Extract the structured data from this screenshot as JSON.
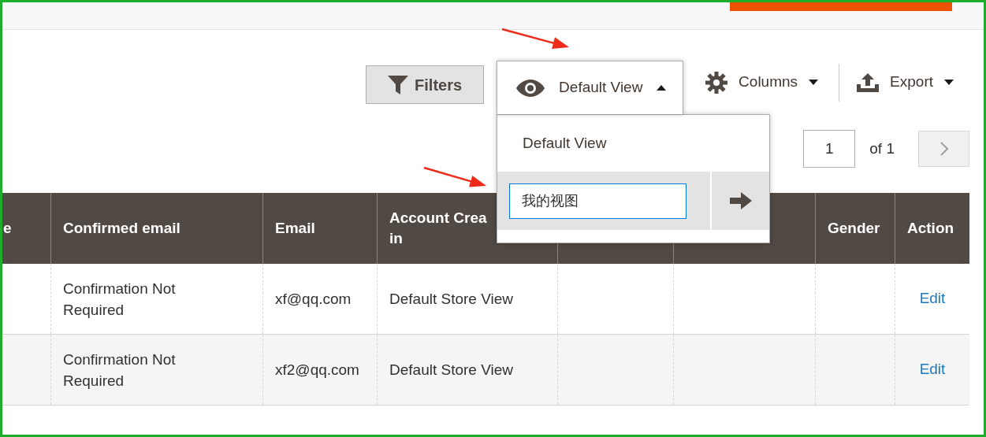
{
  "toolbar": {
    "filters": "Filters",
    "view_switcher": {
      "label": "Default View",
      "expanded": true,
      "options": [
        {
          "label": "Default View"
        }
      ],
      "new_view": {
        "value": "我的视图"
      }
    },
    "columns": "Columns",
    "export": "Export"
  },
  "pagination": {
    "page": "1",
    "total": "of 1"
  },
  "table": {
    "columns": [
      {
        "heading": "e"
      },
      {
        "heading": "Confirmed email"
      },
      {
        "heading": "Email"
      },
      {
        "heading": "Account Crea in"
      },
      {},
      {},
      {
        "heading": "Gender"
      },
      {
        "heading": "Action"
      }
    ],
    "rows": [
      {
        "confirmed_email": "Confirmation Not Required",
        "email": "xf@qq.com",
        "account_created_in": "Default Store View",
        "action": "Edit"
      },
      {
        "confirmed_email": "Confirmation Not Required",
        "email": "xf2@qq.com",
        "account_created_in": "Default Store View",
        "action": "Edit"
      }
    ]
  }
}
